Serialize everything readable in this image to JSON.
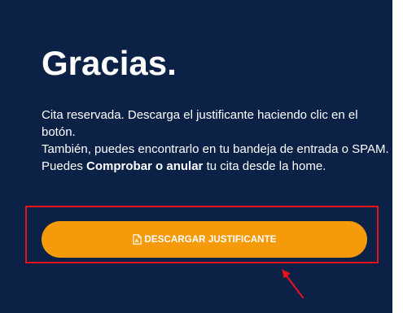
{
  "page": {
    "title": "Gracias.",
    "message": {
      "line1": "Cita reservada. Descarga el justificante haciendo clic en el botón.",
      "line2_before": "También, puedes encontrarlo en tu bandeja de entrada o SPAM. Puedes ",
      "line2_link": "Comprobar o anular",
      "line2_after": " tu cita desde la home."
    },
    "download_button": {
      "icon": "pdf-file-icon",
      "label": "DESCARGAR JUSTIFICANTE"
    }
  },
  "annotation": {
    "box_color": "#e8111c",
    "arrow_color": "#e8111c"
  },
  "colors": {
    "background": "#0c2146",
    "button": "#f49a0b",
    "text": "#ffffff"
  }
}
